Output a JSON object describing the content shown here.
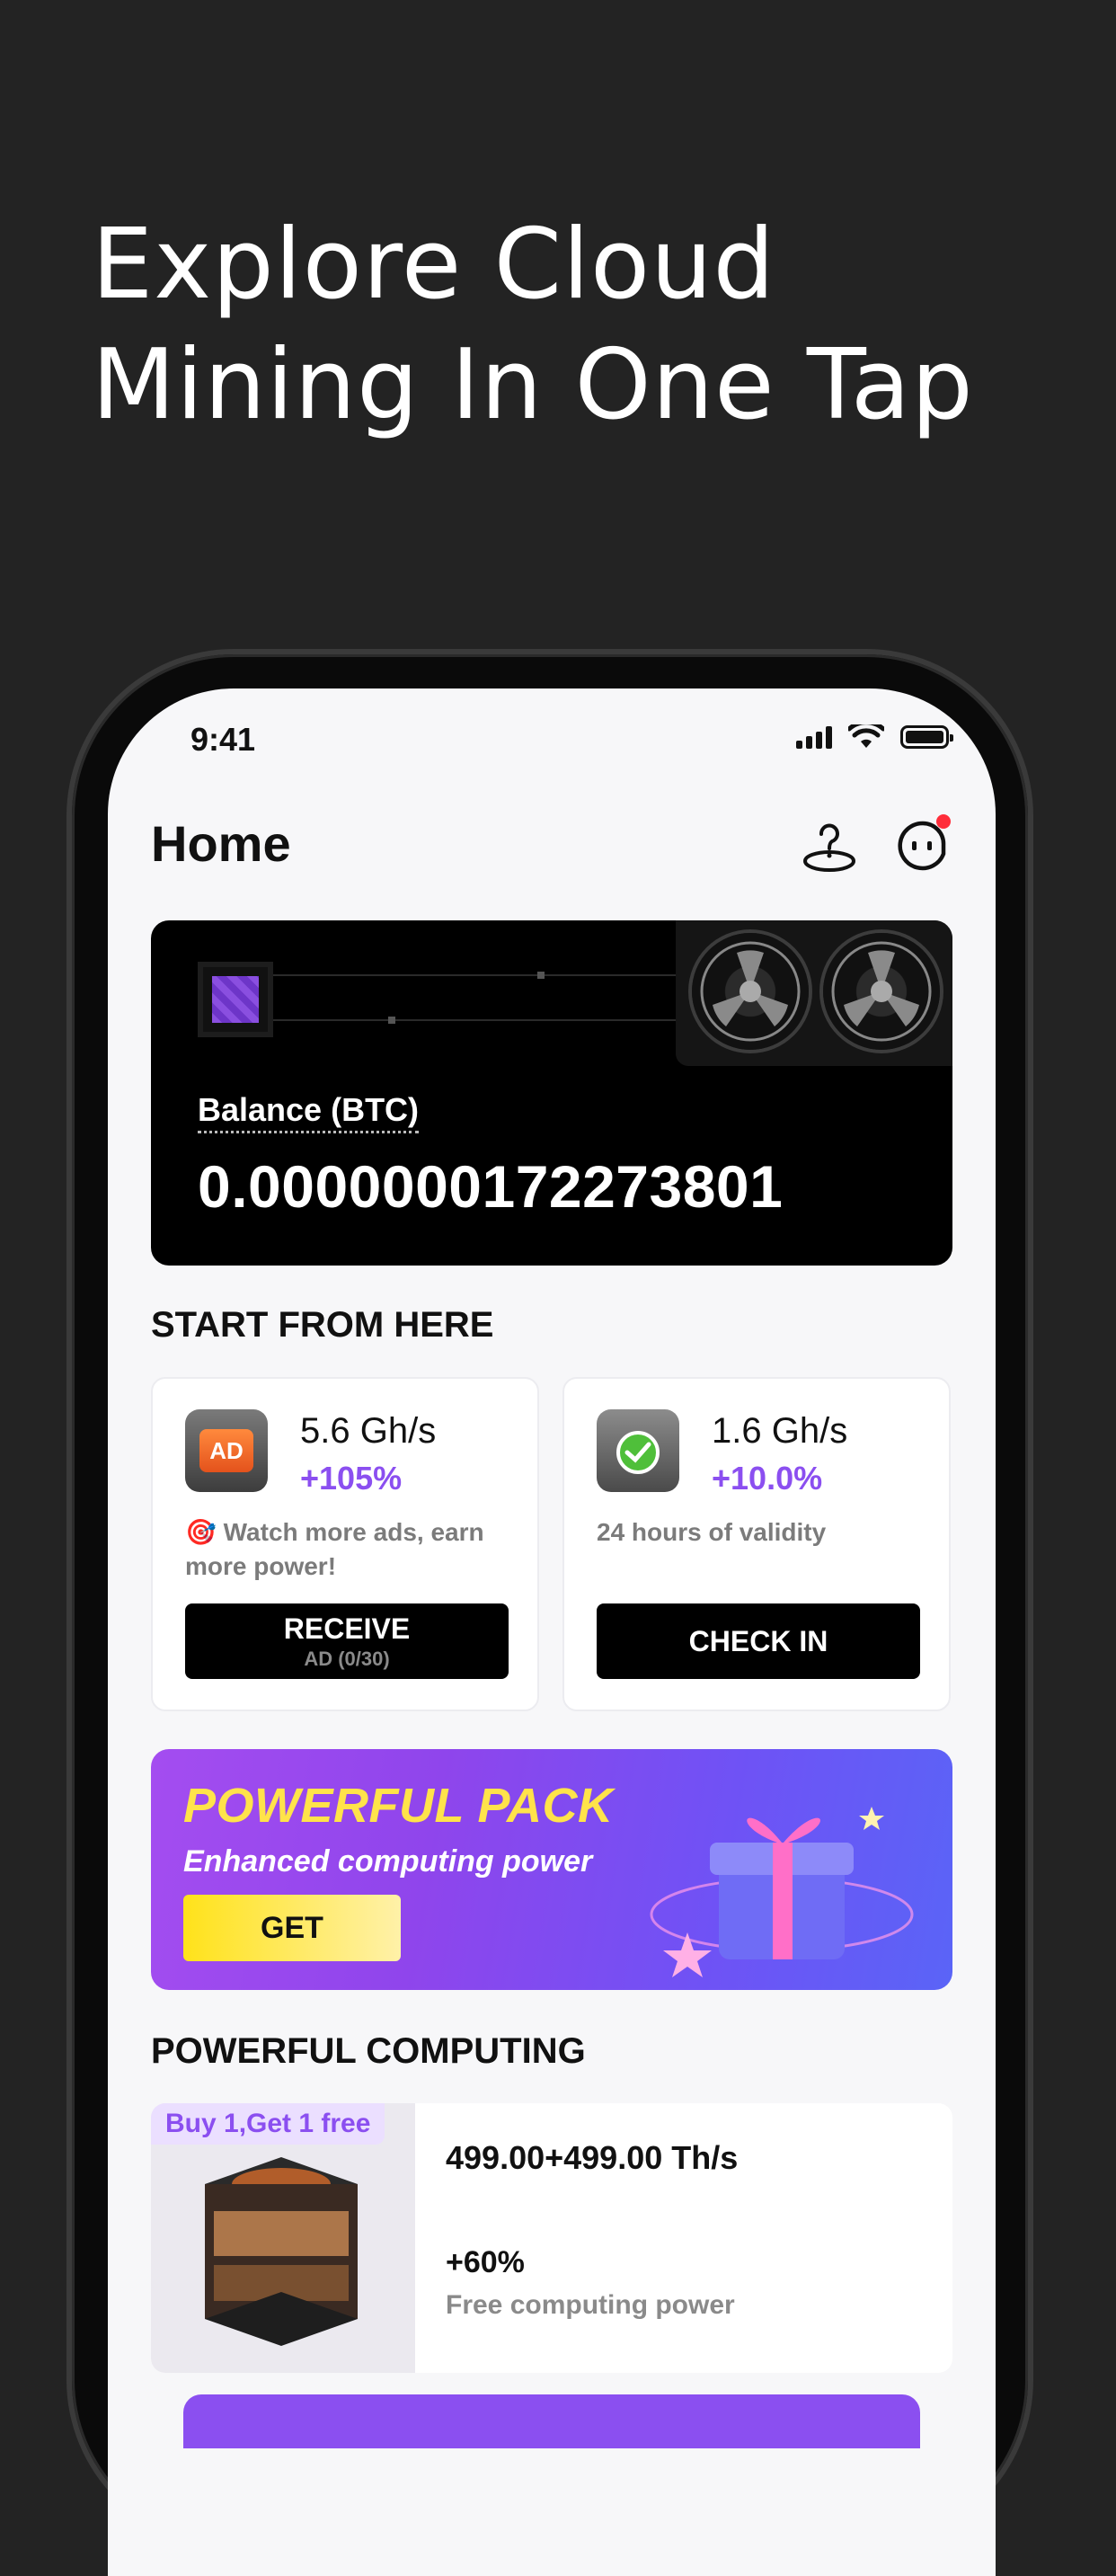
{
  "headline": {
    "line1": "Explore Cloud",
    "line2": "Mining In One Tap"
  },
  "status_bar": {
    "time": "9:41"
  },
  "header": {
    "title": "Home"
  },
  "balance": {
    "label": "Balance (BTC)",
    "value": "0.0000000172273801"
  },
  "start_section": {
    "title": "START FROM HERE",
    "cards": [
      {
        "rate": "5.6 Gh/s",
        "bonus": "+105%",
        "desc_icon": "🎯",
        "desc": "Watch more ads, earn more power!",
        "button_label": "RECEIVE",
        "button_sub": "AD (0/30)",
        "icon": "ad-icon"
      },
      {
        "rate": "1.6 Gh/s",
        "bonus": "+10.0%",
        "desc": "24 hours of validity",
        "button_label": "CHECK IN",
        "icon": "check-icon"
      }
    ]
  },
  "promo": {
    "title": "POWERFUL PACK",
    "subtitle": "Enhanced computing power",
    "button_label": "GET"
  },
  "computing_section": {
    "title": "POWERFUL COMPUTING",
    "product": {
      "tag": "Buy 1,Get 1 free",
      "rate": "499.00+499.00 Th/s",
      "bonus": "+60%",
      "desc": "Free computing power"
    }
  },
  "colors": {
    "accent": "#8b4ff0",
    "promo_title": "#ffe34a",
    "background": "#232323"
  }
}
